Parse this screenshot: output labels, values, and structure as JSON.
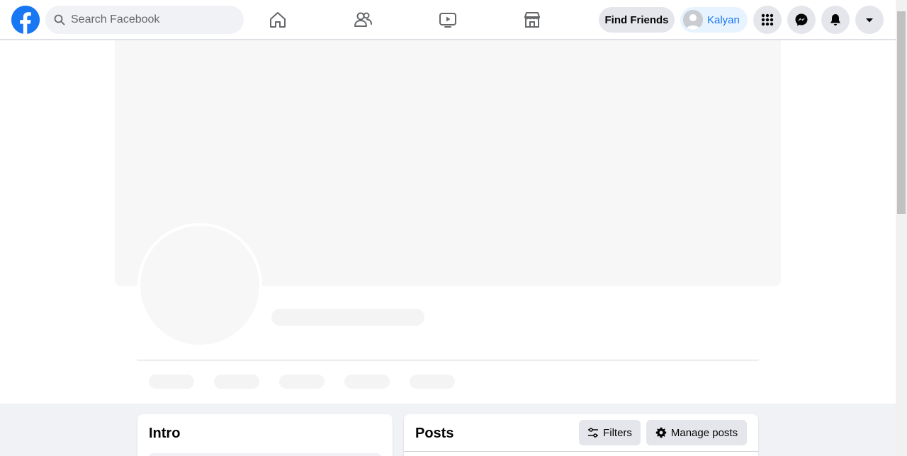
{
  "header": {
    "search": {
      "placeholder": "Search Facebook"
    },
    "find_friends_label": "Find Friends",
    "profile_name": "Kalyan"
  },
  "intro": {
    "title": "Intro"
  },
  "posts": {
    "title": "Posts",
    "filters_label": "Filters",
    "manage_label": "Manage posts"
  },
  "colors": {
    "brand": "#1877f2",
    "page_bg": "#f0f2f5",
    "button_bg": "#e4e6eb",
    "profile_chip_bg": "#e7f3ff"
  },
  "icons": {
    "logo": "facebook-logo-icon",
    "search": "search-icon",
    "home": "home-icon",
    "friends": "friends-icon",
    "watch": "watch-icon",
    "marketplace": "marketplace-icon",
    "menu": "grid-menu-icon",
    "messenger": "messenger-icon",
    "notifications": "bell-icon",
    "account": "caret-down-icon",
    "filters": "sliders-icon",
    "manage": "gear-icon"
  }
}
